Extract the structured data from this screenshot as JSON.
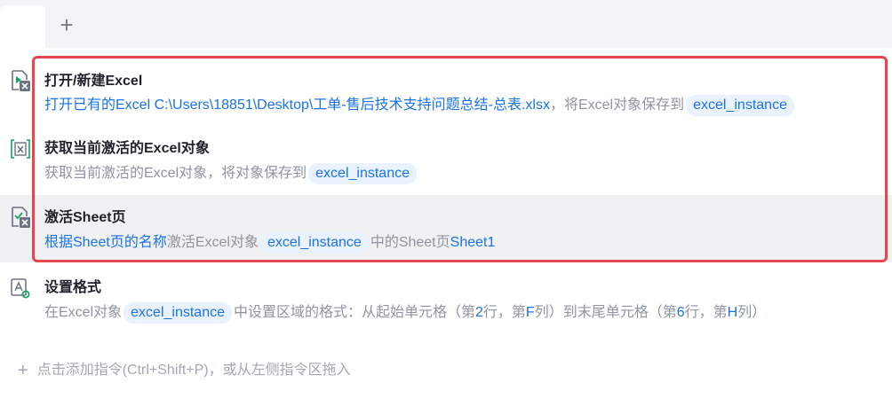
{
  "tabs": {
    "add_icon": "plus-icon",
    "add_glyph": "+"
  },
  "steps": [
    {
      "icon": "excel-open-icon",
      "title": "打开/新建Excel",
      "desc_pre": "打开已有的Excel C:\\Users\\18851\\Desktop\\工单-售后技术支持问题总结-总表.xlsx",
      "desc_mid": "，将Excel对象保存到",
      "chip": "excel_instance"
    },
    {
      "icon": "excel-get-active-icon",
      "title": "获取当前激活的Excel对象",
      "desc_pre": "获取当前激活的Excel对象，将对象保存到",
      "chip": "excel_instance"
    },
    {
      "icon": "excel-activate-sheet-icon",
      "title": "激活Sheet页",
      "desc_a": "根据Sheet页的名称",
      "desc_b": "激活Excel对象",
      "chip": "excel_instance",
      "desc_c": "中的Sheet页",
      "desc_d": "Sheet1"
    },
    {
      "icon": "excel-format-icon",
      "title": "设置格式",
      "desc_a": "在Excel对象",
      "chip": "excel_instance",
      "desc_b": "中设置区域的格式：从起始单元格（第",
      "row_start": "2",
      "desc_c": "行，第",
      "col_start": "F",
      "desc_d": "列）到末尾单元格（第",
      "row_end": "6",
      "desc_e": "行，第",
      "col_end": "H",
      "desc_f": "列）"
    }
  ],
  "add_instruction": "点击添加指令(Ctrl+Shift+P)，或从左侧指令区拖入",
  "colors": {
    "accent": "#1a73e8",
    "selection": "#e5474e",
    "chip_bg": "#eaf2ff",
    "muted": "#8f959e"
  }
}
